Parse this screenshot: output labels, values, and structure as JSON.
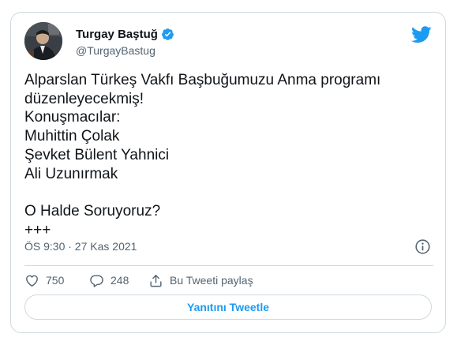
{
  "author": {
    "display_name": "Turgay Baştuğ",
    "handle": "@TurgayBastug",
    "verified": true
  },
  "tweet": {
    "text": "Alparslan Türkeş Vakfı Başbuğumuzu Anma programı düzenleyecekmiş!\nKonuşmacılar:\nMuhittin Çolak\nŞevket Bülent Yahnici\nAli Uzunırmak\n\nO Halde Soruyoruz?\n+++",
    "timestamp": "ÖS 9:30 · 27 Kas 2021"
  },
  "actions": {
    "like_count": "750",
    "reply_count": "248",
    "share_label": "Bu Tweeti paylaş"
  },
  "reply_button_label": "Yanıtını Tweetle",
  "colors": {
    "brand_blue": "#1d9bf0",
    "text_primary": "#0f1419",
    "text_secondary": "#536471",
    "border": "#cfd9de"
  },
  "icons": [
    "verified-badge-icon",
    "twitter-bird-icon",
    "info-icon",
    "heart-icon",
    "reply-bubble-icon",
    "share-icon"
  ]
}
